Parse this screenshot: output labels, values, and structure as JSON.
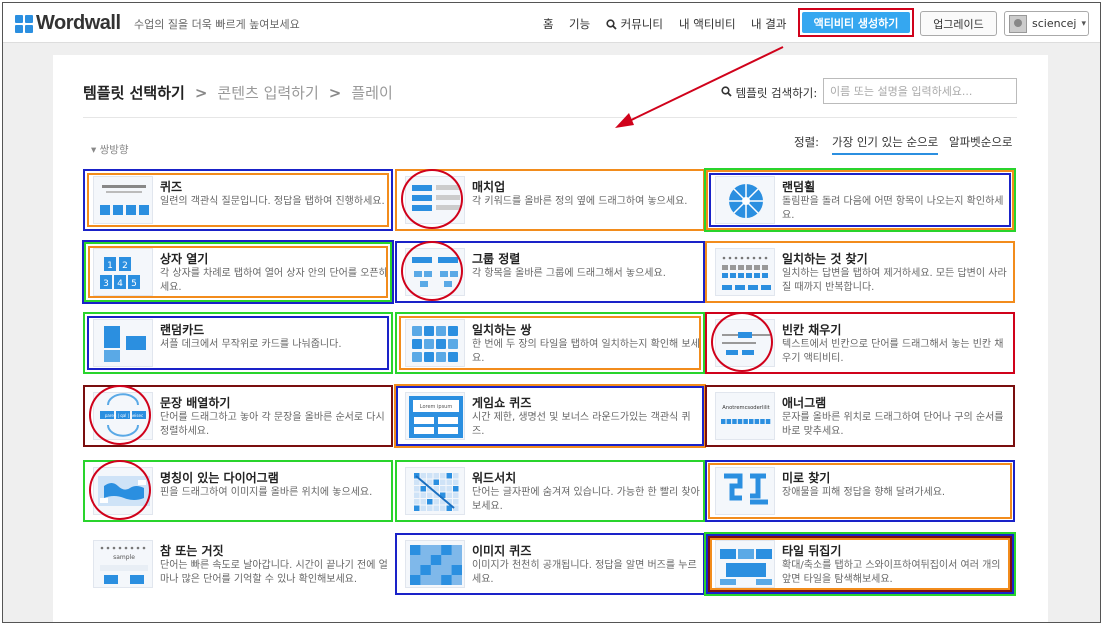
{
  "brand": {
    "logo_text": "Wordwall",
    "tagline": "수업의 질을 더욱 빠르게 높여보세요"
  },
  "nav": {
    "home": "홈",
    "features": "기능",
    "community": "커뮤니티",
    "my_activities": "내 액티비티",
    "my_results": "내 결과"
  },
  "buttons": {
    "create": "액티비티 생성하기",
    "upgrade": "업그레이드"
  },
  "user": {
    "name": "sciencej"
  },
  "breadcrumb": {
    "step1": "템플릿 선택하기",
    "step2": "콘텐츠 입력하기",
    "step3": "플레이"
  },
  "search": {
    "label": "템플릿 검색하기:",
    "placeholder": "이름 또는 설명을 입력하세요..."
  },
  "section_label": "쌍방향",
  "sort": {
    "label": "정렬:",
    "popular": "가장 인기 있는 순으로",
    "alpha": "알파벳순으로"
  },
  "thumb_text": {
    "countdown": "Lorem ipsum",
    "sample": "sample",
    "anagram": "Anotremcsoderlilit",
    "word_pair": "paren | qal | neisec",
    "placeholder_line": "",
    "digits": [
      "1",
      "2",
      "3",
      "4",
      "5"
    ]
  },
  "annotation_colors": {
    "red": "#d0021b",
    "blue": "#1a22c8",
    "orange": "#f28c1c",
    "green": "#29d42c",
    "dark_red": "#7a0e0e"
  },
  "templates": [
    {
      "title": "퀴즈",
      "desc": "일련의 객관식 질문입니다. 정답을 탭하여 진행하세요.",
      "icon": "quiz-thumb"
    },
    {
      "title": "매치업",
      "desc": "각 키워드를 올바른 정의 옆에 드래그하여 놓으세요.",
      "icon": "matchup-thumb"
    },
    {
      "title": "랜덤휠",
      "desc": "돌림판을 돌려 다음에 어떤 항목이 나오는지 확인하세요.",
      "icon": "wheel-thumb"
    },
    {
      "title": "상자 열기",
      "desc": "각 상자를 차례로 탭하여 열어 상자 안의 단어를 오픈하세요.",
      "icon": "boxes-thumb"
    },
    {
      "title": "그룹 정렬",
      "desc": "각 항목을 올바른 그룹에 드래그해서 놓으세요.",
      "icon": "group-sort-thumb"
    },
    {
      "title": "일치하는 것 찾기",
      "desc": "일치하는 답변을 탭하여 제거하세요. 모든 답변이 사라질 때까지 반복합니다.",
      "icon": "find-match-thumb"
    },
    {
      "title": "랜덤카드",
      "desc": "셔플 데크에서 무작위로 카드를 나눠줍니다.",
      "icon": "cards-thumb"
    },
    {
      "title": "일치하는 쌍",
      "desc": "한 번에 두 장의 타일을 탭하여 일치하는지 확인해 보세요.",
      "icon": "pairs-thumb"
    },
    {
      "title": "빈칸 채우기",
      "desc": "텍스트에서 빈칸으로 단어를 드래그해서 놓는 빈칸 채우기 액티비티.",
      "icon": "blank-thumb"
    },
    {
      "title": "문장 배열하기",
      "desc": "단어를 드래그하고 놓아 각 문장을 올바른 순서로 다시 정렬하세요.",
      "icon": "unjumble-thumb"
    },
    {
      "title": "게임쇼 퀴즈",
      "desc": "시간 제한, 생명선 및 보너스 라운드가있는 객관식 퀴즈.",
      "icon": "gameshow-thumb"
    },
    {
      "title": "애너그램",
      "desc": "문자를 올바른 위치로 드래그하여 단어나 구의 순서를 바로 맞추세요.",
      "icon": "anagram-thumb"
    },
    {
      "title": "명칭이 있는 다이어그램",
      "desc": "핀을 드래그하여 이미지를 올바른 위치에 놓으세요.",
      "icon": "diagram-thumb"
    },
    {
      "title": "워드서치",
      "desc": "단어는 글자판에 숨겨져 있습니다. 가능한 한 빨리 찾아보세요.",
      "icon": "wordsearch-thumb"
    },
    {
      "title": "미로 찾기",
      "desc": "장애물을 피해 정답을 향해 달려가세요.",
      "icon": "maze-thumb"
    },
    {
      "title": "참 또는 거짓",
      "desc": "단어는 빠른 속도로 날아갑니다. 시간이 끝나기 전에 얼마나 많은 단어를 기억할 수 있나 확인해보세요.",
      "icon": "true-false-thumb"
    },
    {
      "title": "이미지 퀴즈",
      "desc": "이미지가 천천히 공개됩니다. 정답을 알면 버즈를 누르세요.",
      "icon": "image-quiz-thumb"
    },
    {
      "title": "타일 뒤집기",
      "desc": "확대/축소를 탭하고 스와이프하여뒤집이서 여러 개의 앞면 타일을 탐색해보세요.",
      "icon": "flip-tiles-thumb"
    }
  ]
}
